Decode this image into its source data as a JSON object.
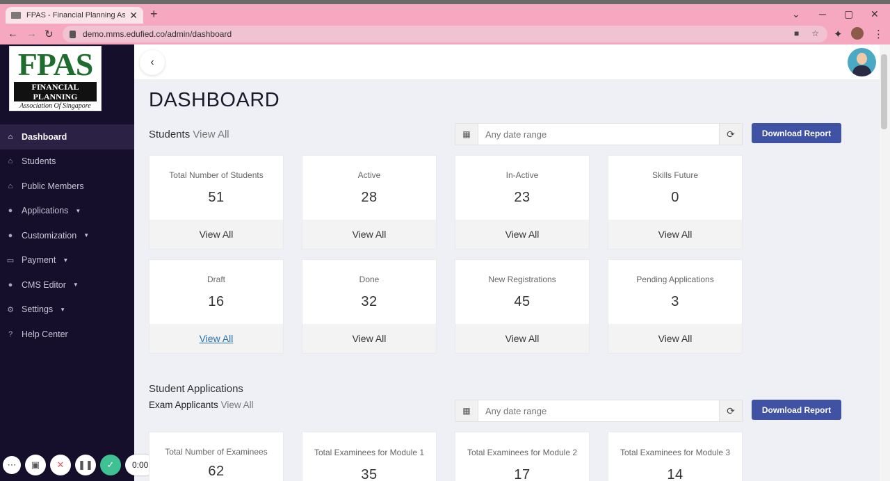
{
  "browser": {
    "tab_title": "FPAS - Financial Planning Associa",
    "url": "demo.mms.edufied.co/admin/dashboard"
  },
  "logo": {
    "brand": "FPAS",
    "line1": "FINANCIAL PLANNING",
    "line2": "Association Of Singapore"
  },
  "sidebar": {
    "items": [
      {
        "label": "Dashboard",
        "icon": "home-icon",
        "active": true
      },
      {
        "label": "Students",
        "icon": "home-icon"
      },
      {
        "label": "Public Members",
        "icon": "home-icon"
      },
      {
        "label": "Applications",
        "icon": "users-icon",
        "dropdown": true
      },
      {
        "label": "Customization",
        "icon": "users-icon",
        "dropdown": true
      },
      {
        "label": "Payment",
        "icon": "money-icon",
        "dropdown": true
      },
      {
        "label": "CMS Editor",
        "icon": "users-icon",
        "dropdown": true
      },
      {
        "label": "Settings",
        "icon": "gear-icon",
        "dropdown": true
      },
      {
        "label": "Help Center",
        "icon": "question-icon"
      }
    ]
  },
  "recorder": {
    "time": "0:00"
  },
  "main": {
    "title": "DASHBOARD",
    "students_section": {
      "label": "Students",
      "view_all": "View All"
    },
    "date_range_placeholder": "Any date range",
    "download_label": "Download Report",
    "student_cards": [
      {
        "label": "Total Number of Students",
        "value": "51",
        "footer": "View All"
      },
      {
        "label": "Active",
        "value": "28",
        "footer": "View All"
      },
      {
        "label": "In-Active",
        "value": "23",
        "footer": "View All"
      },
      {
        "label": "Skills Future",
        "value": "0",
        "footer": "View All"
      },
      {
        "label": "Draft",
        "value": "16",
        "footer": "View All"
      },
      {
        "label": "Done",
        "value": "32",
        "footer": "View All"
      },
      {
        "label": "New Registrations",
        "value": "45",
        "footer": "View All"
      },
      {
        "label": "Pending Applications",
        "value": "3",
        "footer": "View All"
      }
    ],
    "applications_section": {
      "title": "Student Applications",
      "sub_label": "Exam Applicants",
      "view_all": "View All"
    },
    "exam_cards": [
      {
        "label": "Total Number of Examinees",
        "value": "62"
      },
      {
        "label": "Total Examinees for Module 1",
        "value": "35"
      },
      {
        "label": "Total Examinees for Module 2",
        "value": "17"
      },
      {
        "label": "Total Examinees for Module 3",
        "value": "14"
      }
    ]
  }
}
